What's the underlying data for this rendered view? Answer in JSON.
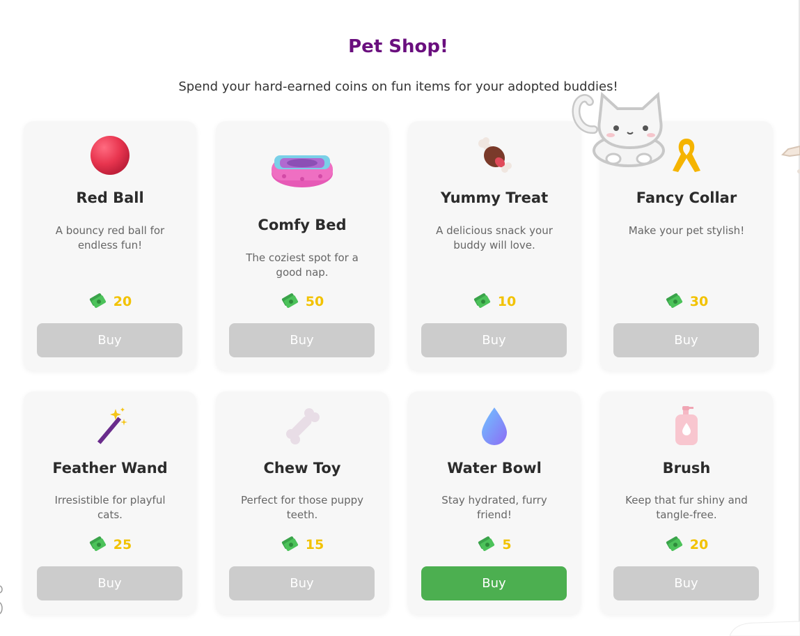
{
  "header": {
    "title": "Pet Shop!",
    "subtitle": "Spend your hard-earned coins on fun items for your adopted buddies!"
  },
  "colors": {
    "title": "#6a0f7e",
    "price": "#f2c200",
    "buy_disabled": "#cccccc",
    "buy_active": "#4caf50",
    "card_bg": "#f7f7f7"
  },
  "items": [
    {
      "name": "Red Ball",
      "description": "A bouncy red ball for endless fun!",
      "price": "20",
      "buy_label": "Buy",
      "icon": "red-ball-icon",
      "buy_enabled": false
    },
    {
      "name": "Comfy Bed",
      "description": "The coziest spot for a good nap.",
      "price": "50",
      "buy_label": "Buy",
      "icon": "pet-bed-icon",
      "buy_enabled": false
    },
    {
      "name": "Yummy Treat",
      "description": "A delicious snack your buddy will love.",
      "price": "10",
      "buy_label": "Buy",
      "icon": "meat-bone-icon",
      "buy_enabled": false
    },
    {
      "name": "Fancy Collar",
      "description": "Make your pet stylish!",
      "price": "30",
      "buy_label": "Buy",
      "icon": "ribbon-icon",
      "buy_enabled": false
    },
    {
      "name": "Feather Wand",
      "description": "Irresistible for playful cats.",
      "price": "25",
      "buy_label": "Buy",
      "icon": "magic-wand-icon",
      "buy_enabled": false
    },
    {
      "name": "Chew Toy",
      "description": "Perfect for those puppy teeth.",
      "price": "15",
      "buy_label": "Buy",
      "icon": "bone-icon",
      "buy_enabled": false
    },
    {
      "name": "Water Bowl",
      "description": "Stay hydrated, furry friend!",
      "price": "5",
      "buy_label": "Buy",
      "icon": "water-drop-icon",
      "buy_enabled": true
    },
    {
      "name": "Brush",
      "description": "Keep that fur shiny and tangle-free.",
      "price": "20",
      "buy_label": "Buy",
      "icon": "lotion-bottle-icon",
      "buy_enabled": false
    }
  ],
  "currency_icon": "money-icon",
  "decorations": [
    "cat-sticker-icon"
  ]
}
